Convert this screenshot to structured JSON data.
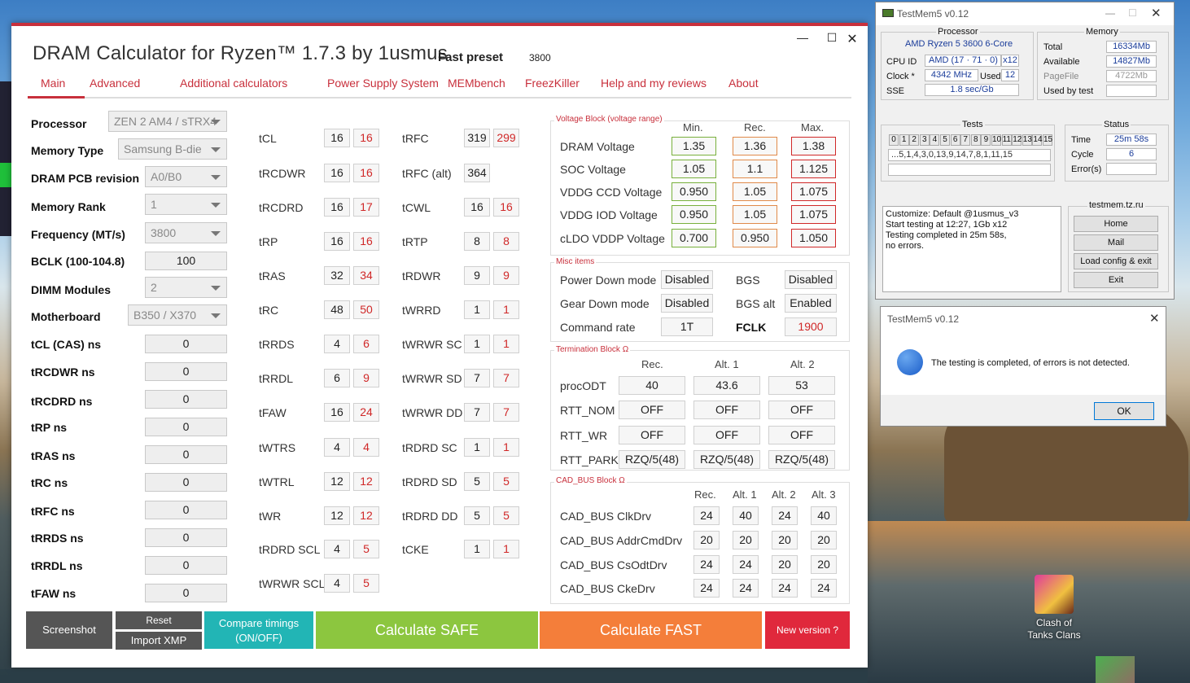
{
  "desktop": {
    "icon_label": "Clash of\nTanks Clans"
  },
  "dram": {
    "title": "DRAM Calculator for Ryzen™ 1.7.3 by 1usmus",
    "preset_label": "Fast preset",
    "preset_value": "3800",
    "nav": [
      "Main",
      "Advanced",
      "Additional calculators",
      "Power Supply System",
      "MEMbench",
      "FreezKiller",
      "Help and my reviews",
      "About"
    ],
    "left": [
      {
        "label": "Processor",
        "value": "ZEN 2 AM4 / sTRX4"
      },
      {
        "label": "Memory Type",
        "value": "Samsung B-die"
      },
      {
        "label": "DRAM PCB revision",
        "value": "A0/B0"
      },
      {
        "label": "Memory Rank",
        "value": "1"
      },
      {
        "label": "Frequency (MT/s)",
        "value": "3800"
      },
      {
        "label": "BCLK (100-104.8)",
        "value": "100"
      },
      {
        "label": "DIMM Modules",
        "value": "2"
      },
      {
        "label": "Motherboard",
        "value": "B350 / X370"
      },
      {
        "label": "tCL (CAS) ns",
        "value": "0"
      },
      {
        "label": "tRCDWR ns",
        "value": "0"
      },
      {
        "label": "tRCDRD ns",
        "value": "0"
      },
      {
        "label": "tRP ns",
        "value": "0"
      },
      {
        "label": "tRAS ns",
        "value": "0"
      },
      {
        "label": "tRC ns",
        "value": "0"
      },
      {
        "label": "tRFC ns",
        "value": "0"
      },
      {
        "label": "tRRDS ns",
        "value": "0"
      },
      {
        "label": "tRRDL ns",
        "value": "0"
      },
      {
        "label": "tFAW ns",
        "value": "0"
      }
    ],
    "timings_a": [
      {
        "label": "tCL",
        "a": "16",
        "b": "16"
      },
      {
        "label": "tRCDWR",
        "a": "16",
        "b": "16"
      },
      {
        "label": "tRCDRD",
        "a": "16",
        "b": "17"
      },
      {
        "label": "tRP",
        "a": "16",
        "b": "16"
      },
      {
        "label": "tRAS",
        "a": "32",
        "b": "34"
      },
      {
        "label": "tRC",
        "a": "48",
        "b": "50"
      },
      {
        "label": "tRRDS",
        "a": "4",
        "b": "6"
      },
      {
        "label": "tRRDL",
        "a": "6",
        "b": "9"
      },
      {
        "label": "tFAW",
        "a": "16",
        "b": "24"
      },
      {
        "label": "tWTRS",
        "a": "4",
        "b": "4"
      },
      {
        "label": "tWTRL",
        "a": "12",
        "b": "12"
      },
      {
        "label": "tWR",
        "a": "12",
        "b": "12"
      },
      {
        "label": "tRDRD SCL",
        "a": "4",
        "b": "5"
      },
      {
        "label": "tWRWR SCL",
        "a": "4",
        "b": "5"
      }
    ],
    "timings_b": [
      {
        "label": "tRFC",
        "a": "319",
        "b": "299"
      },
      {
        "label": "tRFC (alt)",
        "a": "364",
        "b": ""
      },
      {
        "label": "tCWL",
        "a": "16",
        "b": "16"
      },
      {
        "label": "tRTP",
        "a": "8",
        "b": "8"
      },
      {
        "label": "tRDWR",
        "a": "9",
        "b": "9"
      },
      {
        "label": "tWRRD",
        "a": "1",
        "b": "1"
      },
      {
        "label": "tWRWR SC",
        "a": "1",
        "b": "1"
      },
      {
        "label": "tWRWR SD",
        "a": "7",
        "b": "7"
      },
      {
        "label": "tWRWR DD",
        "a": "7",
        "b": "7"
      },
      {
        "label": "tRDRD SC",
        "a": "1",
        "b": "1"
      },
      {
        "label": "tRDRD SD",
        "a": "5",
        "b": "5"
      },
      {
        "label": "tRDRD DD",
        "a": "5",
        "b": "5"
      },
      {
        "label": "tCKE",
        "a": "1",
        "b": "1"
      }
    ],
    "voltage": {
      "group": "Voltage Block (voltage range)",
      "heads": [
        "Min.",
        "Rec.",
        "Max."
      ],
      "rows": [
        {
          "label": "DRAM Voltage",
          "min": "1.35",
          "rec": "1.36",
          "max": "1.38"
        },
        {
          "label": "SOC Voltage",
          "min": "1.05",
          "rec": "1.1",
          "max": "1.125"
        },
        {
          "label": "VDDG  CCD Voltage",
          "min": "0.950",
          "rec": "1.05",
          "max": "1.075"
        },
        {
          "label": "VDDG  IOD Voltage",
          "min": "0.950",
          "rec": "1.05",
          "max": "1.075"
        },
        {
          "label": "cLDO VDDP Voltage",
          "min": "0.700",
          "rec": "0.950",
          "max": "1.050"
        }
      ]
    },
    "misc": {
      "group": "Misc items",
      "power_down": "Power Down mode",
      "power_down_val": "Disabled",
      "bgs": "BGS",
      "bgs_val": "Disabled",
      "gear_down": "Gear Down mode",
      "gear_down_val": "Disabled",
      "bgs_alt": "BGS alt",
      "bgs_alt_val": "Enabled",
      "cmd_rate": "Command rate",
      "cmd_rate_val": "1T",
      "fclk": "FCLK",
      "fclk_val": "1900"
    },
    "term": {
      "group": "Termination Block Ω",
      "heads": [
        "Rec.",
        "Alt. 1",
        "Alt. 2"
      ],
      "rows": [
        {
          "label": "procODT",
          "v": [
            "40",
            "43.6",
            "53"
          ]
        },
        {
          "label": "RTT_NOM",
          "v": [
            "OFF",
            "OFF",
            "OFF"
          ]
        },
        {
          "label": "RTT_WR",
          "v": [
            "OFF",
            "OFF",
            "OFF"
          ]
        },
        {
          "label": "RTT_PARK",
          "v": [
            "RZQ/5(48)",
            "RZQ/5(48)",
            "RZQ/5(48)"
          ]
        }
      ]
    },
    "cad": {
      "group": "CAD_BUS Block Ω",
      "heads": [
        "Rec.",
        "Alt. 1",
        "Alt. 2",
        "Alt. 3"
      ],
      "rows": [
        {
          "label": "CAD_BUS ClkDrv",
          "v": [
            "24",
            "40",
            "24",
            "40"
          ]
        },
        {
          "label": "CAD_BUS AddrCmdDrv",
          "v": [
            "20",
            "20",
            "20",
            "20"
          ]
        },
        {
          "label": "CAD_BUS CsOdtDrv",
          "v": [
            "24",
            "24",
            "20",
            "20"
          ]
        },
        {
          "label": "CAD_BUS CkeDrv",
          "v": [
            "24",
            "24",
            "24",
            "24"
          ]
        }
      ]
    },
    "buttons": {
      "screenshot": "Screenshot",
      "reset": "Reset",
      "import_xmp": "Import XMP",
      "compare1": "Compare timings",
      "compare2": "(ON/OFF)",
      "safe": "Calculate SAFE",
      "fast": "Calculate FAST",
      "new_version": "New version ?"
    }
  },
  "testmem": {
    "title": "TestMem5 v0.12",
    "processor_group": "Processor",
    "cpu_name": "AMD Ryzen 5 3600 6-Core",
    "cpu_id_label": "CPU ID",
    "cpu_id": "AMD  (17 · 71 · 0)",
    "cpu_threads": "x12",
    "clock_label": "Clock *",
    "clock": "4342 MHz",
    "used_label": "Used",
    "used": "12",
    "sse_label": "SSE",
    "sse": "1.8 sec/Gb",
    "memory_group": "Memory",
    "total_label": "Total",
    "total": "16334Mb",
    "available_label": "Available",
    "available": "14827Mb",
    "pagefile_label": "PageFile",
    "pagefile": "4722Mb",
    "usedby_label": "Used by test",
    "usedby": "",
    "tests_group": "Tests",
    "tests": [
      "0",
      "1",
      "2",
      "3",
      "4",
      "5",
      "6",
      "7",
      "8",
      "9",
      "10",
      "11",
      "12",
      "13",
      "14",
      "15"
    ],
    "test_seq": "...5,1,4,3,0,13,9,14,7,8,1,11,15",
    "status_group": "Status",
    "time_label": "Time",
    "time": "25m 58s",
    "cycle_label": "Cycle",
    "cycle": "6",
    "errors_label": "Error(s)",
    "errors": "",
    "log": "Customize: Default @1usmus_v3\nStart testing at 12:27, 1Gb x12\nTesting completed in 25m 58s,\nno errors.",
    "site_group": "testmem.tz.ru",
    "btn_home": "Home",
    "btn_mail": "Mail",
    "btn_load": "Load config & exit",
    "btn_exit": "Exit"
  },
  "dialog": {
    "title": "TestMem5 v0.12",
    "message": "The testing is completed, of errors is not detected.",
    "ok": "OK"
  }
}
